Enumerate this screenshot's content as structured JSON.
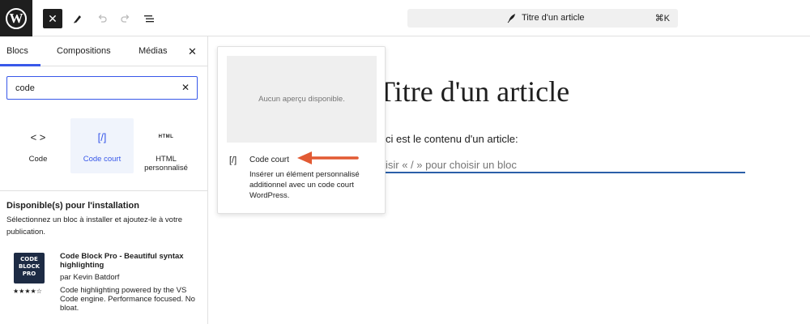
{
  "colors": {
    "accent": "#3858e9",
    "arrow": "#e25a33",
    "logo_bg": "#1e1e1e"
  },
  "topbar": {
    "logo_icon": "wordpress-logo",
    "logo_text": "W",
    "close_icon": "close-icon",
    "close_symbol": "✕",
    "doc_title": "Titre d'un article",
    "shortcut": "⌘K"
  },
  "sidebar": {
    "tabs": [
      "Blocs",
      "Compositions",
      "Médias"
    ],
    "close_symbol": "✕",
    "search": {
      "value": "code",
      "clear_symbol": "✕"
    },
    "blocks": [
      {
        "icon": "< >",
        "label": "Code"
      },
      {
        "icon": "[/]",
        "label": "Code court"
      },
      {
        "icon": "HTML",
        "label": "HTML personnalisé"
      }
    ],
    "install": {
      "title": "Disponible(s) pour l'installation",
      "description": "Sélectionnez un bloc à installer et ajoutez-le à votre publication."
    },
    "plugin": {
      "icon_lines": [
        "CODE",
        "BLOCK",
        "PRO"
      ],
      "rating_stars": "★★★★☆",
      "rating": 4.5,
      "name": "Code Block Pro - Beautiful syntax highlighting",
      "author": "par Kevin Batdorf",
      "description": "Code highlighting powered by the VS Code engine. Performance focused. No bloat."
    }
  },
  "canvas": {
    "post_title": "Titre d'un article",
    "paragraph": "ci est le contenu d'un article:",
    "placeholder": "isir « / » pour choisir un bloc"
  },
  "preview": {
    "no_preview": "Aucun aperçu disponible.",
    "icon": "[/]",
    "name": "Code court",
    "description": "Insérer un élément personnalisé additionnel avec un code court WordPress."
  }
}
